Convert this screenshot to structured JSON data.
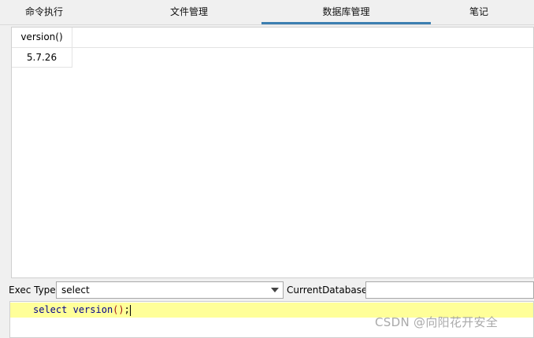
{
  "tabs": [
    {
      "label": "命令执行"
    },
    {
      "label": "文件管理"
    },
    {
      "label": "数据库管理",
      "active": true
    },
    {
      "label": "笔记"
    }
  ],
  "accent_color": "#3c7fb1",
  "result_table": {
    "columns": [
      "version()"
    ],
    "rows": [
      [
        "5.7.26"
      ]
    ]
  },
  "exec": {
    "type_label": "Exec Type",
    "type_value": "select",
    "db_label": "CurrentDatabase",
    "db_value": ""
  },
  "editor": {
    "keyword": "select",
    "function": "version",
    "parens": "()",
    "terminator": ";"
  },
  "watermark": "CSDN @向阳花开安全"
}
